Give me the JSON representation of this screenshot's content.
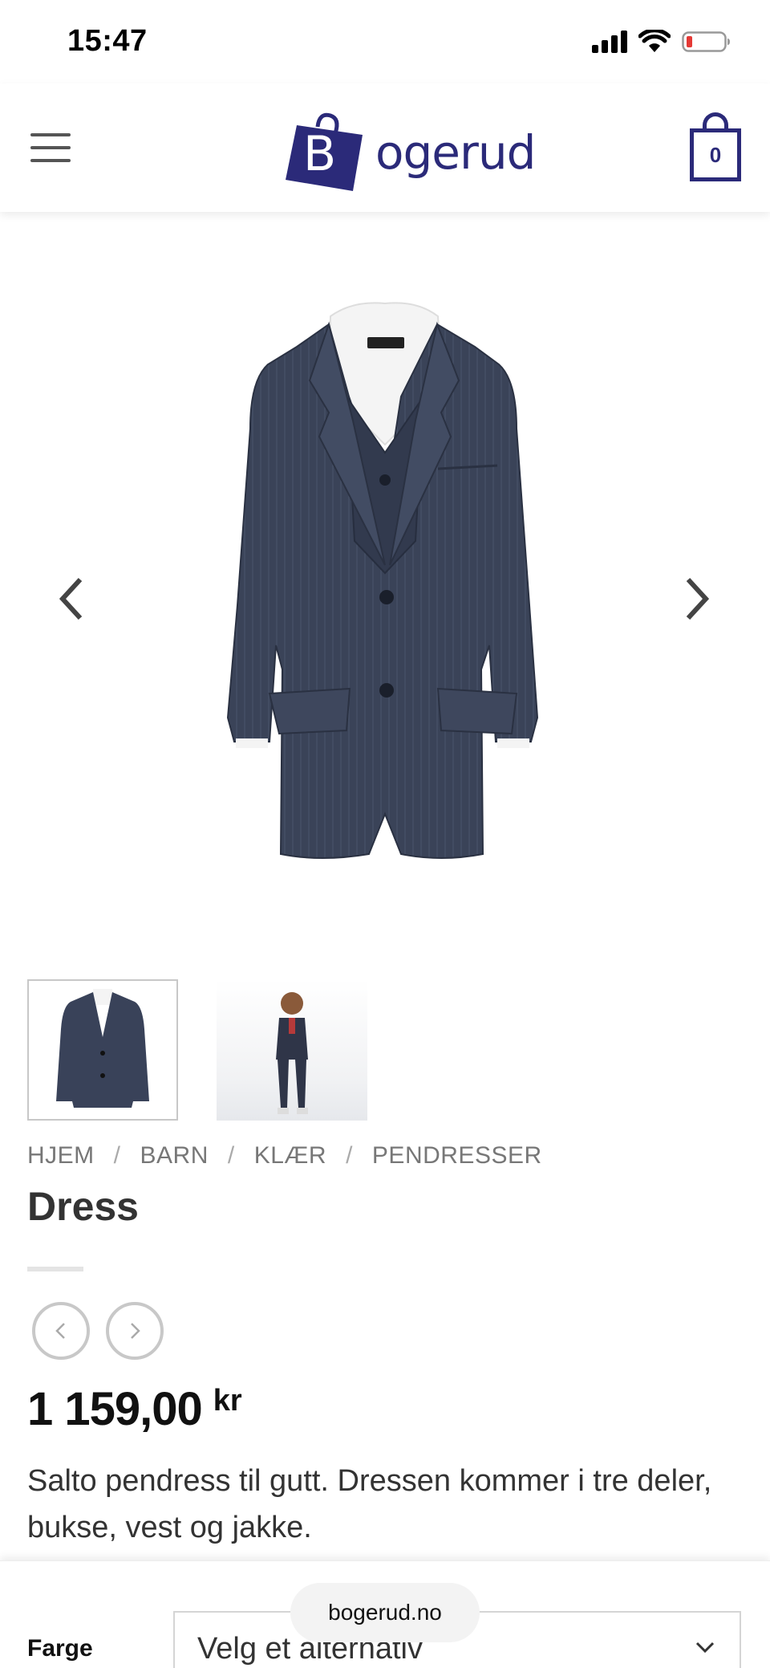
{
  "status_bar": {
    "time": "15:47",
    "icons": [
      "signal-icon",
      "wifi-icon",
      "battery-icon"
    ]
  },
  "header": {
    "menu_icon": "menu-icon",
    "logo_text": "ogerud",
    "logo_letter": "B",
    "cart_count": "0",
    "brand_color": "#2b2a79"
  },
  "gallery": {
    "prev_icon": "chevron-left-icon",
    "next_icon": "chevron-right-icon",
    "thumbnails": [
      "suit-jacket-thumbnail",
      "boy-in-suit-thumbnail"
    ]
  },
  "breadcrumb": [
    "HJEM",
    "BARN",
    "KLÆR",
    "PENDRESSER"
  ],
  "product": {
    "title": "Dress",
    "price": "1 159,00",
    "currency": "kr",
    "description": "Salto pendress til gutt. Dressen kommer i tre deler, bukse, vest og jakke."
  },
  "variant": {
    "label": "Farge",
    "value": "Velg et alternativ"
  },
  "browser": {
    "url": "bogerud.no"
  }
}
